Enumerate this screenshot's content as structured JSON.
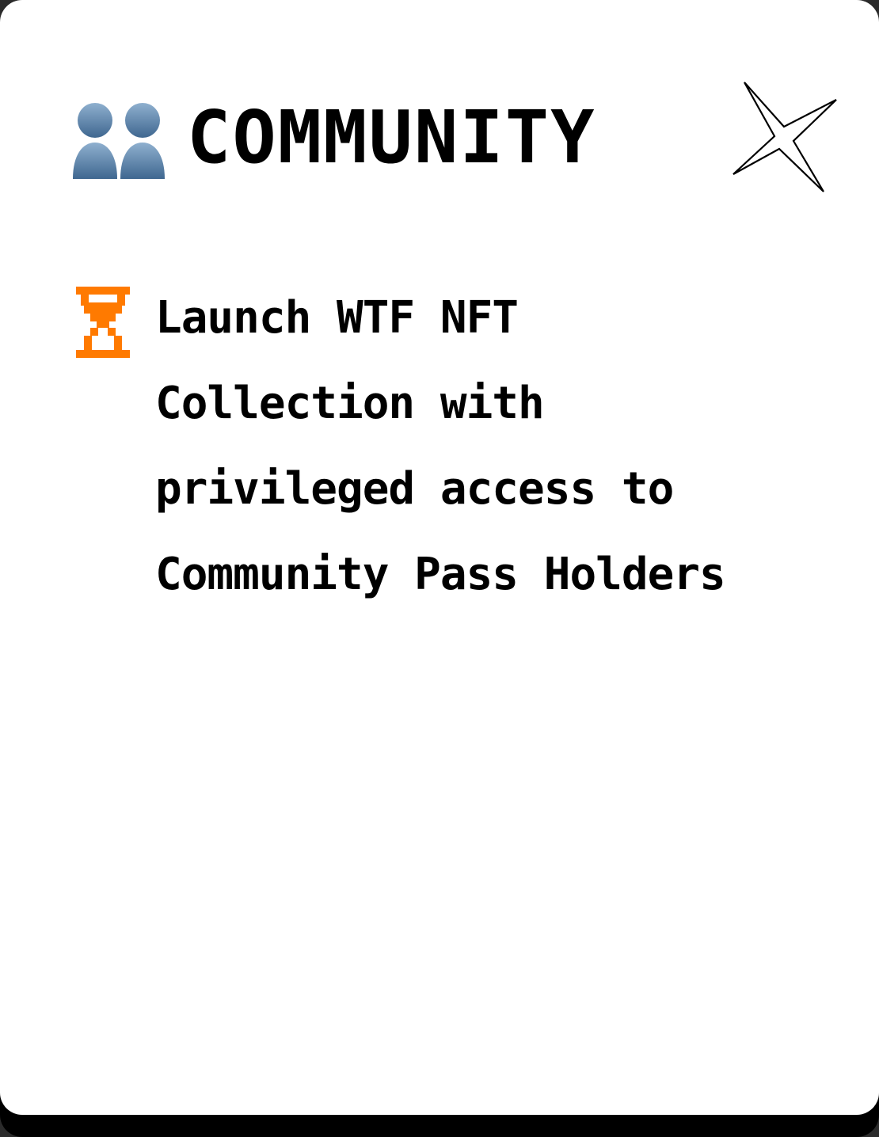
{
  "section": {
    "title": "COMMUNITY",
    "title_icon": "busts-in-silhouette-icon",
    "decoration_icon": "four-point-star-icon"
  },
  "items": [
    {
      "status_icon": "hourglass-icon",
      "status_color": "#ff7a00",
      "text": "Launch WTF NFT Collection with privileged access to Community Pass Holders"
    }
  ],
  "colors": {
    "card_background": "#ffffff",
    "text": "#000000",
    "accent": "#ff7a00",
    "people_icon": "#5a7fa8"
  }
}
